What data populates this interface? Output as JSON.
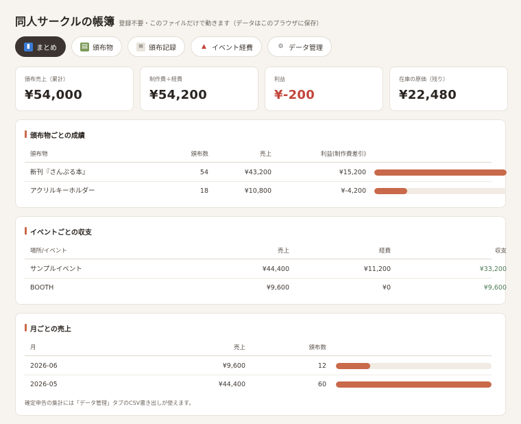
{
  "header": {
    "title": "同人サークルの帳簿",
    "subtitle": "登録不要・このファイルだけで動きます（データはこのブラウザに保存）"
  },
  "tabs": [
    {
      "label": "まとめ",
      "icon": "chart-icon",
      "active": true
    },
    {
      "label": "頒布物",
      "icon": "books-icon",
      "active": false
    },
    {
      "label": "頒布記録",
      "icon": "ledger-icon",
      "active": false
    },
    {
      "label": "イベント経費",
      "icon": "tent-icon",
      "active": false
    },
    {
      "label": "データ管理",
      "icon": "gear-icon",
      "active": false
    }
  ],
  "stats": [
    {
      "label": "頒布売上（累計）",
      "value": "¥54,000"
    },
    {
      "label": "制作費＋経費",
      "value": "¥54,200"
    },
    {
      "label": "利益",
      "value": "¥-200"
    },
    {
      "label": "在庫の原価（残り）",
      "value": "¥22,480"
    }
  ],
  "items_card": {
    "title": "頒布物ごとの成績",
    "headers": {
      "name": "頒布物",
      "qty": "頒布数",
      "sales": "売上",
      "profit": "利益(制作費差引)"
    },
    "rows": [
      {
        "name": "新刊『さんぷる本』",
        "qty": "54",
        "sales": "¥43,200",
        "profit": "¥15,200",
        "bar": 1.0
      },
      {
        "name": "アクリルキーホルダー",
        "qty": "18",
        "sales": "¥10,800",
        "profit": "¥-4,200",
        "bar": 0.25
      }
    ]
  },
  "events_card": {
    "title": "イベントごとの収支",
    "headers": {
      "place": "場所/イベント",
      "sales": "売上",
      "expense": "経費",
      "balance": "収支"
    },
    "rows": [
      {
        "place": "サンプルイベント",
        "sales": "¥44,400",
        "expense": "¥11,200",
        "balance": "¥33,200"
      },
      {
        "place": "BOOTH",
        "sales": "¥9,600",
        "expense": "¥0",
        "balance": "¥9,600"
      }
    ]
  },
  "monthly_card": {
    "title": "月ごとの売上",
    "headers": {
      "month": "月",
      "sales": "売上",
      "qty": "頒布数"
    },
    "rows": [
      {
        "month": "2026-06",
        "sales": "¥9,600",
        "qty": "12",
        "bar": 0.22
      },
      {
        "month": "2026-05",
        "sales": "¥44,400",
        "qty": "60",
        "bar": 1.0
      }
    ],
    "footnote": "確定申告の集計には「データ管理」タブのCSV書き出しが使えます。"
  },
  "colors": {
    "accent": "#c8694a",
    "negative": "#c2453a",
    "positive": "#4d7a55",
    "active_tab": "#3b3430"
  }
}
